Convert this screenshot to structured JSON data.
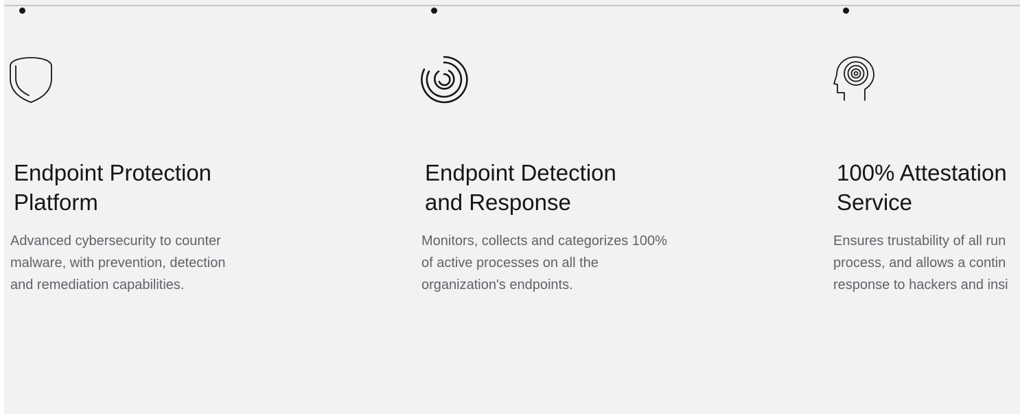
{
  "cards": [
    {
      "icon": "shield-icon",
      "title": "Endpoint Protection\nPlatform",
      "description": "Advanced cybersecurity to counter\nmalware, with prevention, detection\nand remediation capabilities."
    },
    {
      "icon": "target-rings-icon",
      "title": "Endpoint Detection\nand Response",
      "description": "Monitors, collects and categorizes 100%\nof active processes on all the\norganization's endpoints."
    },
    {
      "icon": "head-target-icon",
      "title": "100% Attestation\nService",
      "description": "Ensures trustability of all run\nprocess, and allows a contin\nresponse to hackers and insi"
    }
  ],
  "colors": {
    "background": "#f2f2f2",
    "timeline": "#c8c8c8",
    "title": "#161616",
    "description": "#5f6368",
    "icon_stroke": "#161616"
  }
}
